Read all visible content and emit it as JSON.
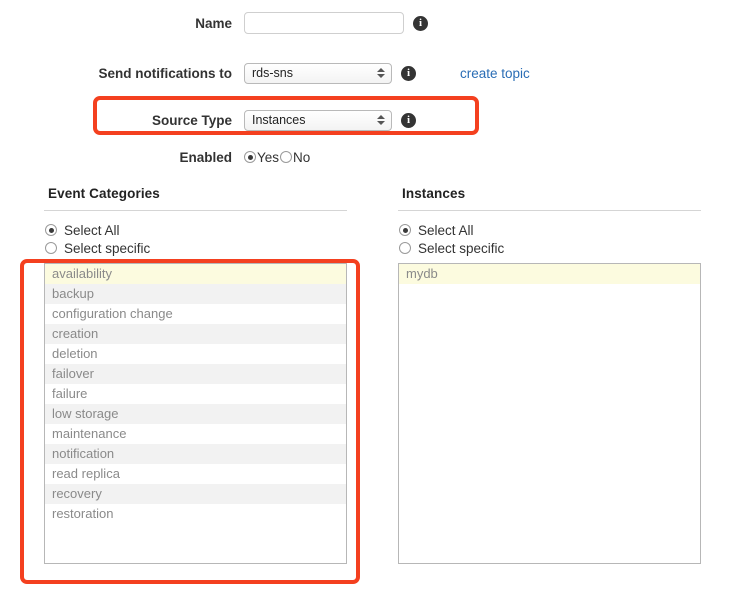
{
  "form": {
    "rows": [
      {
        "label": "Name",
        "control": "text-input",
        "value": "",
        "placeholder": "",
        "info": true
      },
      {
        "label": "Send notifications to",
        "control": "select",
        "value": "rds-sns",
        "info": true,
        "link": "create topic"
      },
      {
        "label": "Source Type",
        "control": "select",
        "value": "Instances",
        "info": true
      },
      {
        "label": "Enabled",
        "control": "radio-pair",
        "options": [
          "Yes",
          "No"
        ],
        "selected": "Yes",
        "info": false
      }
    ]
  },
  "panels": {
    "event_categories": {
      "title": "Event Categories",
      "scope_options": [
        "Select All",
        "Select specific"
      ],
      "scope_selected": "Select All",
      "items": [
        "availability",
        "backup",
        "configuration change",
        "creation",
        "deletion",
        "failover",
        "failure",
        "low storage",
        "maintenance",
        "notification",
        "read replica",
        "recovery",
        "restoration"
      ],
      "highlighted_item": "availability"
    },
    "instances": {
      "title": "Instances",
      "scope_options": [
        "Select All",
        "Select specific"
      ],
      "scope_selected": "Select All",
      "items": [
        "mydb"
      ],
      "highlighted_item": "mydb"
    }
  },
  "annotations": {
    "color": "#f4401f",
    "boxes": [
      {
        "name": "source-type-highlight"
      },
      {
        "name": "event-categories-list-highlight"
      }
    ]
  }
}
